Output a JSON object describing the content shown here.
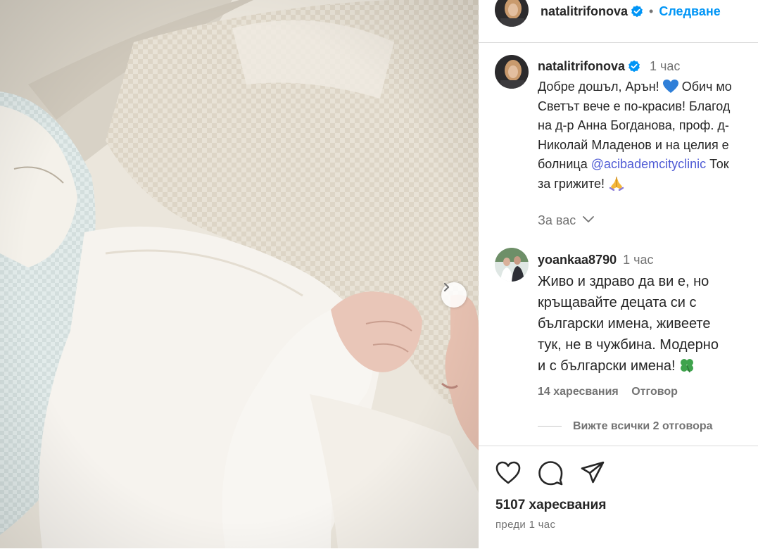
{
  "post": {
    "username": "natalitrifonova",
    "follow_label": "Следване",
    "separator": "•"
  },
  "caption": {
    "username": "natalitrifonova",
    "time": "1 час",
    "lines": [
      "Добре дошъл, Арън!",
      "Обич мо",
      "Светът вече е по-красив! Благод",
      "на д-р Анна Богданова, проф. д-",
      "Николай Младенов и на целия е",
      "болница",
      "@acibademcityclinic",
      "Ток",
      "за грижите!"
    ],
    "for_you_label": "За вас"
  },
  "comment": {
    "username": "yoankaa8790",
    "time": "1 час",
    "lines": [
      "Живо и здраво да ви е, но",
      "кръщавайте децата си с",
      "български имена, живеете",
      "тук, не в чужбина. Модерно",
      "и с български имена!"
    ],
    "likes": "14 харесвания",
    "reply_label": "Отговор",
    "view_replies": "Вижте всички 2 отговора"
  },
  "footer": {
    "likes": "5107 харесвания",
    "posted": "преди 1 час"
  },
  "icons": {
    "like": "heart-icon",
    "comment": "comment-bubble-icon",
    "share": "paper-plane-icon",
    "next": "chevron-right-icon",
    "verified": "verified-badge-icon",
    "heart_emoji": "blue-heart-emoji",
    "prayer_emoji": "folded-hands-emoji",
    "clover_emoji": "four-leaf-clover-emoji"
  },
  "colors": {
    "link": "#0095f6",
    "mention": "#4f5bd5",
    "verified": "#0095f6",
    "muted": "#737373"
  }
}
